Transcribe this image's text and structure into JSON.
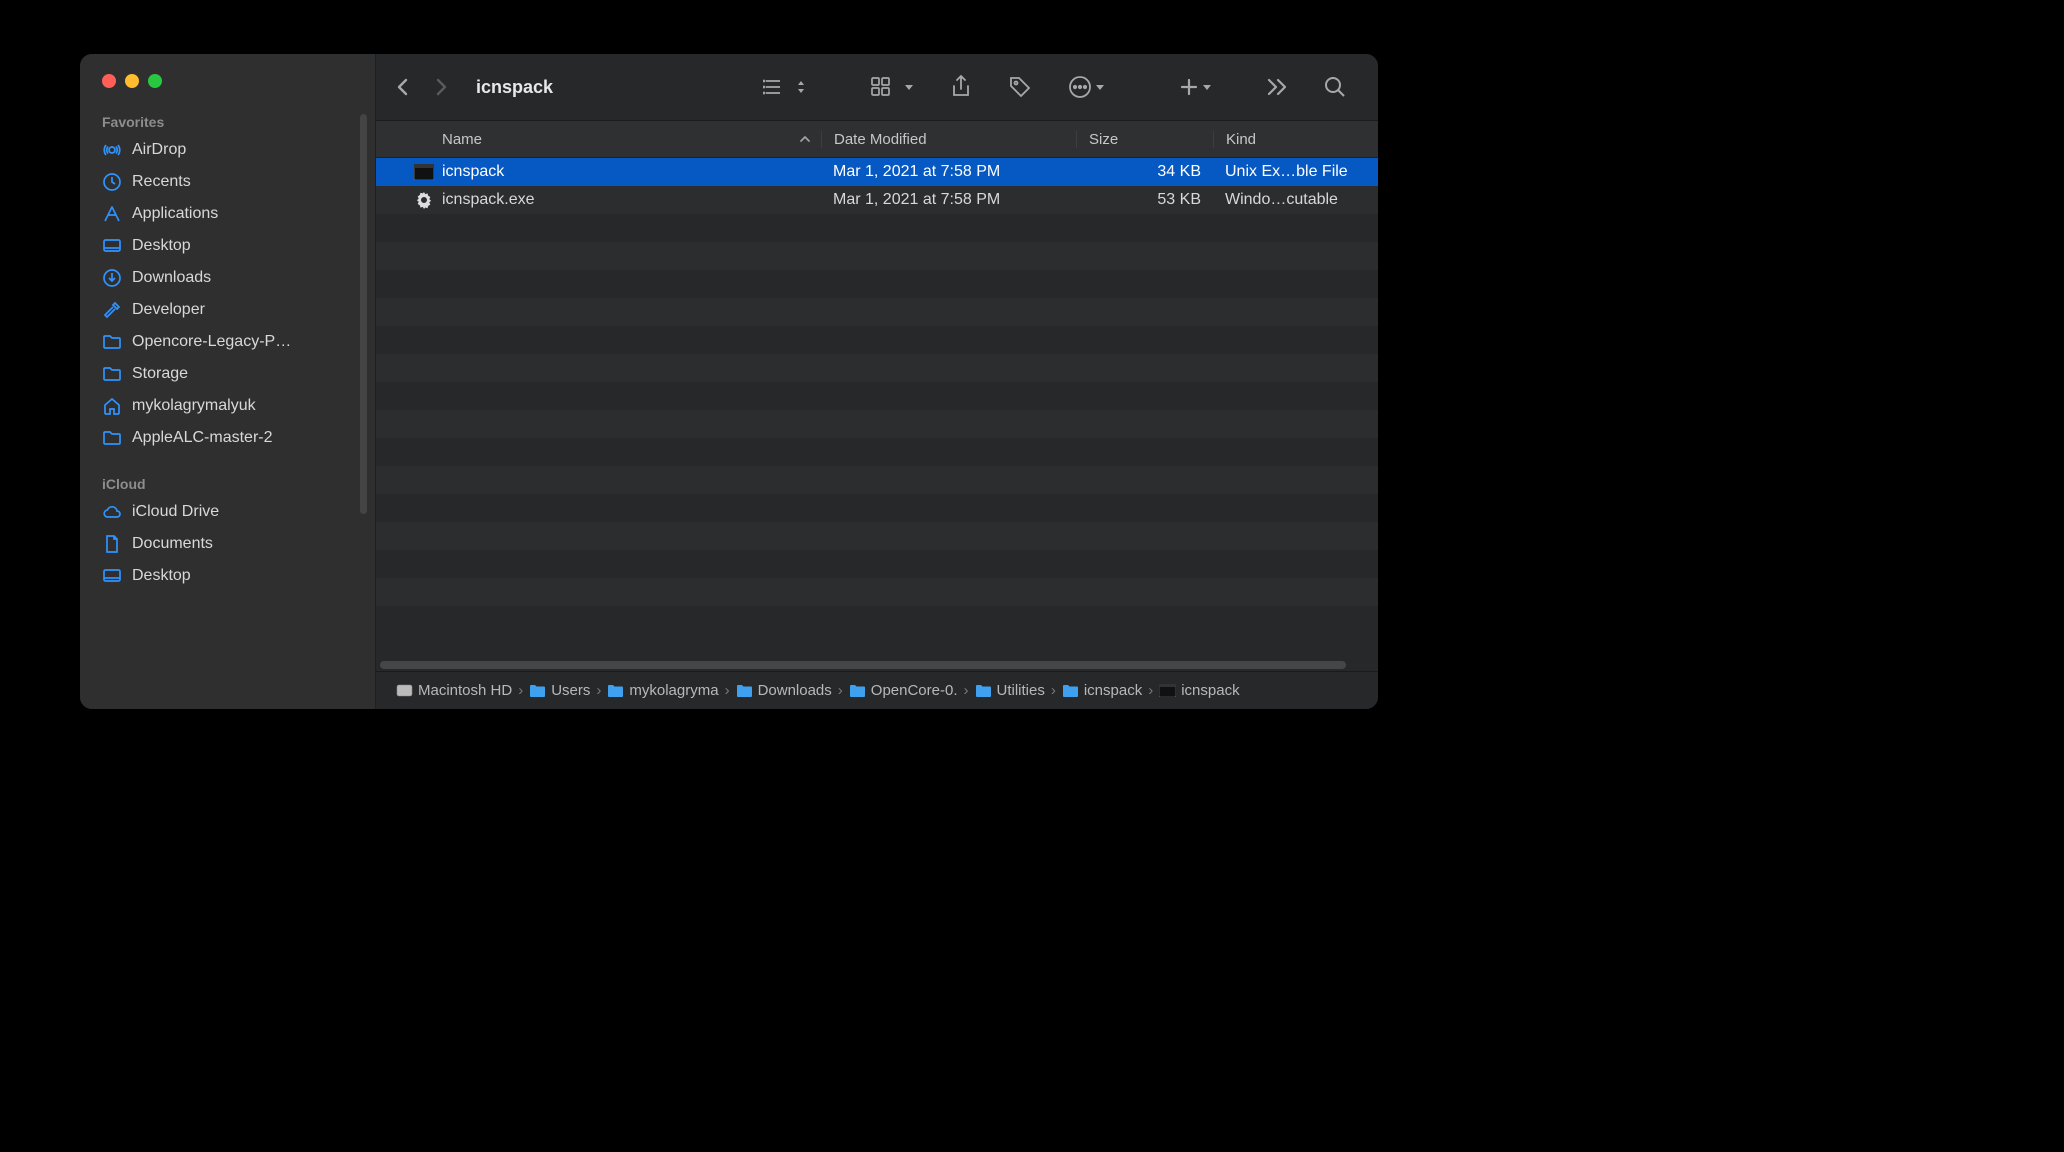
{
  "window": {
    "title": "icnspack"
  },
  "sidebar": {
    "sections": [
      {
        "label": "Favorites",
        "items": [
          {
            "icon": "airdrop",
            "label": "AirDrop"
          },
          {
            "icon": "clock",
            "label": "Recents"
          },
          {
            "icon": "apps",
            "label": "Applications"
          },
          {
            "icon": "desktop",
            "label": "Desktop"
          },
          {
            "icon": "download",
            "label": "Downloads"
          },
          {
            "icon": "hammer",
            "label": "Developer"
          },
          {
            "icon": "folder",
            "label": "Opencore-Legacy-P…"
          },
          {
            "icon": "folder",
            "label": "Storage"
          },
          {
            "icon": "house",
            "label": "mykolagrymalyuk"
          },
          {
            "icon": "folder",
            "label": "AppleALC-master-2"
          }
        ]
      },
      {
        "label": "iCloud",
        "items": [
          {
            "icon": "cloud",
            "label": "iCloud Drive"
          },
          {
            "icon": "document",
            "label": "Documents"
          },
          {
            "icon": "desktop",
            "label": "Desktop"
          }
        ]
      }
    ]
  },
  "columns": {
    "name": "Name",
    "date": "Date Modified",
    "size": "Size",
    "kind": "Kind"
  },
  "files": [
    {
      "icon": "exec",
      "name": "icnspack",
      "date": "Mar 1, 2021 at 7:58 PM",
      "size": "34 KB",
      "kind": "Unix Ex…ble File",
      "selected": true
    },
    {
      "icon": "gear",
      "name": "icnspack.exe",
      "date": "Mar 1, 2021 at 7:58 PM",
      "size": "53 KB",
      "kind": "Windo…cutable",
      "selected": false
    }
  ],
  "pathbar": [
    {
      "icon": "disk",
      "label": "Macintosh HD"
    },
    {
      "icon": "folder-blue",
      "label": "Users"
    },
    {
      "icon": "folder-blue",
      "label": "mykolagryma"
    },
    {
      "icon": "folder-blue",
      "label": "Downloads"
    },
    {
      "icon": "folder-blue",
      "label": "OpenCore-0."
    },
    {
      "icon": "folder-blue",
      "label": "Utilities"
    },
    {
      "icon": "folder-blue",
      "label": "icnspack"
    },
    {
      "icon": "exec",
      "label": "icnspack"
    }
  ]
}
